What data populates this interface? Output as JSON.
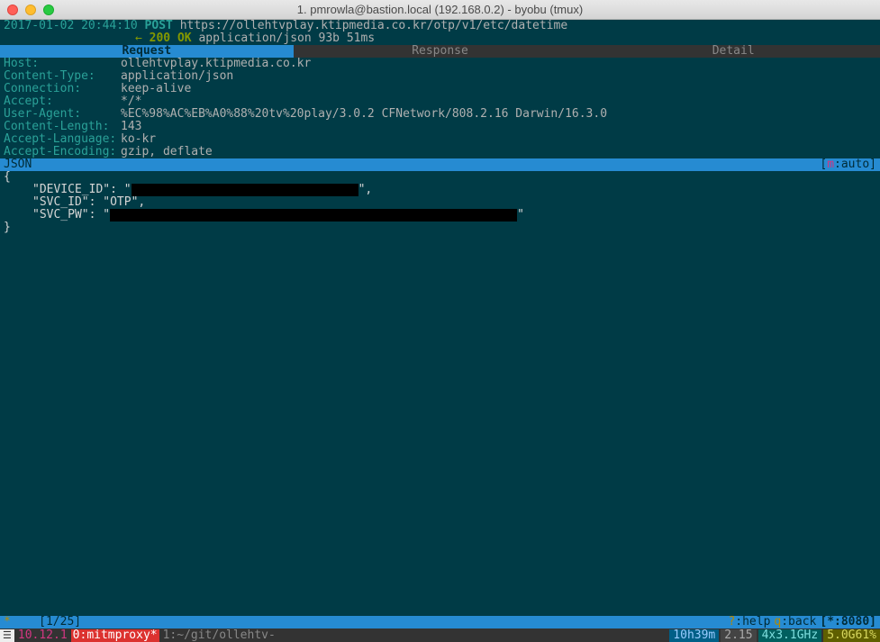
{
  "titlebar": {
    "title": "1. pmrowla@bastion.local (192.168.0.2) - byobu (tmux)"
  },
  "request": {
    "timestamp": "2017-01-02 20:44:10",
    "method": "POST",
    "url": "https://ollehtvplay.ktipmedia.co.kr/otp/v1/etc/datetime",
    "status_arrow": "←",
    "status_code": "200 OK",
    "status_rest": "application/json 93b 51ms"
  },
  "tabs": {
    "request": "Request",
    "response": "Response",
    "detail": "Detail"
  },
  "headers": [
    {
      "key": "Host:",
      "val": "ollehtvplay.ktipmedia.co.kr"
    },
    {
      "key": "Content-Type:",
      "val": "application/json"
    },
    {
      "key": "Connection:",
      "val": "keep-alive"
    },
    {
      "key": "Accept:",
      "val": "*/*"
    },
    {
      "key": "User-Agent:",
      "val": "%EC%98%AC%EB%A0%88%20tv%20play/3.0.2 CFNetwork/808.2.16 Darwin/16.3.0"
    },
    {
      "key": "Content-Length:",
      "val": "143"
    },
    {
      "key": "Accept-Language:",
      "val": "ko-kr"
    },
    {
      "key": "Accept-Encoding:",
      "val": "gzip, deflate"
    }
  ],
  "json_bar": {
    "label": "JSON",
    "mode_prefix": "[",
    "mode_m": "m",
    "mode_suffix": ":auto]"
  },
  "body": {
    "open": "{",
    "line1_pre": "\"DEVICE_ID\": \"",
    "line1_post": "\",",
    "line2": "\"SVC_ID\": \"OTP\",",
    "line3_pre": "\"SVC_PW\": \"",
    "line3_post": "\"",
    "close": "}"
  },
  "statusbar": {
    "left_star": "*",
    "position": "[1/25]",
    "help_q": "?",
    "help_txt": ":help",
    "back_q": "q",
    "back_txt": ":back",
    "port": "[*:8080]"
  },
  "tmux": {
    "logo": "☰",
    "os": "10.12.1",
    "win": "0:mitmproxy*",
    "path": "1:~/git/ollehtv-",
    "uptime": "10h39m",
    "load": "2.15",
    "cpu": "4x3.1GHz",
    "mem": "5.0G61%"
  }
}
